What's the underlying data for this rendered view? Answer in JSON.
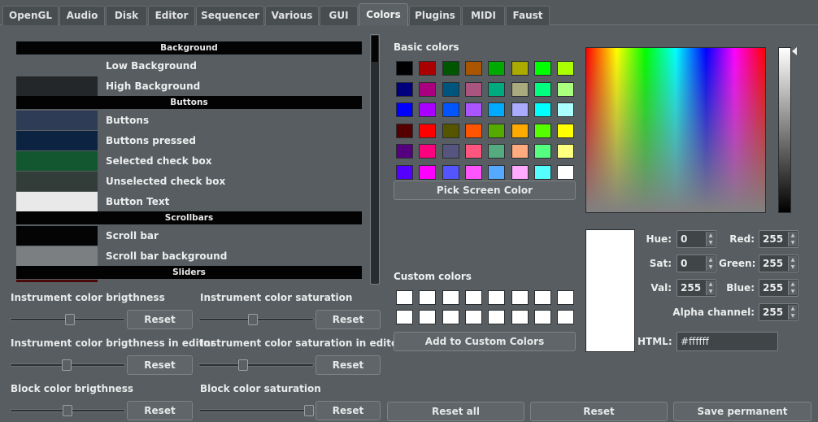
{
  "tabs": [
    {
      "label": "OpenGL"
    },
    {
      "label": "Audio"
    },
    {
      "label": "Disk"
    },
    {
      "label": "Editor"
    },
    {
      "label": "Sequencer"
    },
    {
      "label": "Various"
    },
    {
      "label": "GUI"
    },
    {
      "label": "Colors",
      "active": true
    },
    {
      "label": "Plugins"
    },
    {
      "label": "MIDI"
    },
    {
      "label": "Faust"
    }
  ],
  "color_list": {
    "sections": {
      "background": "Background",
      "buttons": "Buttons",
      "scrollbars": "Scrollbars",
      "sliders": "Sliders"
    },
    "items": [
      {
        "label": "Low Background",
        "color": "#575d60"
      },
      {
        "label": "High Background",
        "color": "#23272a"
      },
      {
        "label": "Buttons",
        "color": "#2e3d55"
      },
      {
        "label": "Buttons pressed",
        "color": "#0c2342"
      },
      {
        "label": "Selected check box",
        "color": "#135730"
      },
      {
        "label": "Unselected check box",
        "color": "#323d39"
      },
      {
        "label": "Button Text",
        "color": "#e9e9e9"
      },
      {
        "label": "Scroll bar",
        "color": "#040404"
      },
      {
        "label": "Scroll bar background",
        "color": "#7b7f82"
      }
    ],
    "partial_item_color": "#4a0a0a"
  },
  "sliders": {
    "instr_brightness": {
      "label": "Instrument color brigthness",
      "value": 0.52,
      "reset": "Reset"
    },
    "instr_saturation": {
      "label": "Instrument color saturation",
      "value": 0.47,
      "reset": "Reset"
    },
    "instr_brightness_editor": {
      "label": "Instrument color brigthness in editor",
      "value": 0.49,
      "reset": "Reset"
    },
    "instr_saturation_editor": {
      "label": "Instrument color saturation in editor",
      "value": 0.38,
      "reset": "Reset"
    },
    "block_brightness": {
      "label": "Block color brigthness",
      "value": 0.5,
      "reset": "Reset"
    },
    "block_saturation": {
      "label": "Block color saturation",
      "value": 1.0,
      "reset": "Reset"
    }
  },
  "bottom_buttons": {
    "reset_all": "Reset all",
    "reset": "Reset",
    "save_permanent": "Save permanent"
  },
  "picker": {
    "basic_colors_label": "Basic colors",
    "basic_colors": [
      "#000000",
      "#aa0000",
      "#005500",
      "#aa5500",
      "#00aa00",
      "#aaaa00",
      "#00ff00",
      "#aaff00",
      "#00007f",
      "#aa007f",
      "#00557f",
      "#aa557f",
      "#00aa7f",
      "#aaaa7f",
      "#00ff7f",
      "#aaff7f",
      "#0000ff",
      "#aa00ff",
      "#0055ff",
      "#aa55ff",
      "#00aaff",
      "#aaaaff",
      "#00ffff",
      "#aaffff",
      "#550000",
      "#ff0000",
      "#555500",
      "#ff5500",
      "#55aa00",
      "#ffaa00",
      "#55ff00",
      "#ffff00",
      "#55007f",
      "#ff007f",
      "#55557f",
      "#ff557f",
      "#55aa7f",
      "#ffaa7f",
      "#55ff7f",
      "#ffff7f",
      "#5500ff",
      "#ff00ff",
      "#5555ff",
      "#ff55ff",
      "#55aaff",
      "#ffaaff",
      "#55ffff",
      "#ffffff"
    ],
    "pick_screen_color": "Pick Screen Color",
    "custom_colors_label": "Custom colors",
    "add_to_custom": "Add to Custom Colors",
    "fields": {
      "hue_label": "Hue:",
      "hue": "0",
      "sat_label": "Sat:",
      "sat": "0",
      "val_label": "Val:",
      "val": "255",
      "red_label": "Red:",
      "red": "255",
      "green_label": "Green:",
      "green": "255",
      "blue_label": "Blue:",
      "blue": "255",
      "alpha_label": "Alpha channel:",
      "alpha": "255",
      "html_label": "HTML:",
      "html": "#ffffff"
    },
    "current_color": "#ffffff"
  }
}
